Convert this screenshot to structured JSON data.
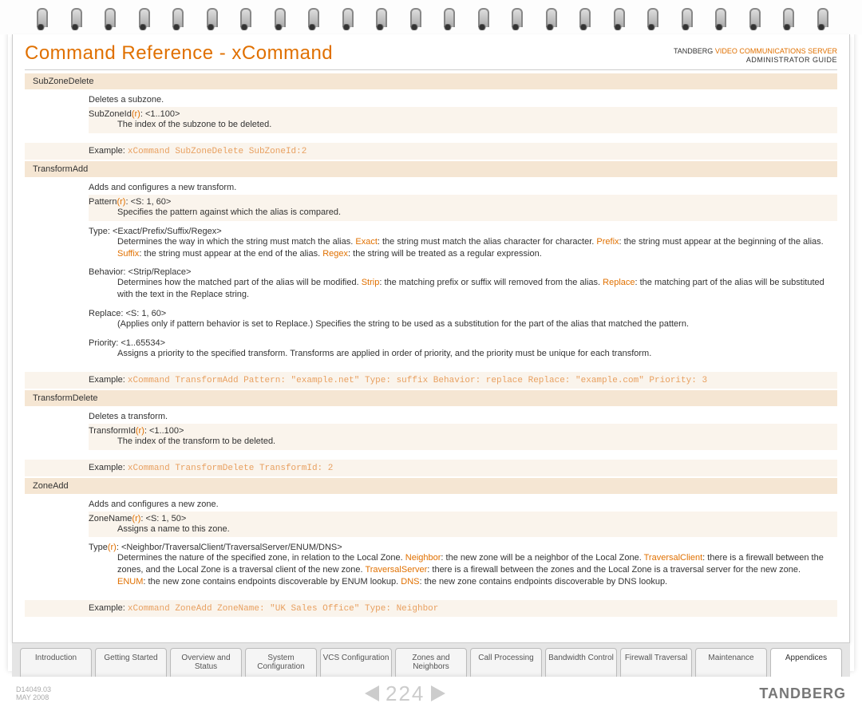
{
  "header": {
    "title": "Command Reference - xCommand",
    "brand_company": "TANDBERG",
    "brand_product": "VIDEO COMMUNICATIONS SERVER",
    "brand_subtitle": "ADMINISTRATOR GUIDE"
  },
  "commands": {
    "subzonedelete": {
      "name": "SubZoneDelete",
      "desc": "Deletes a subzone.",
      "p1_name": "SubZoneId",
      "p1_req": "(r)",
      "p1_range": ": <1..100>",
      "p1_detail": "The index of the subzone to be deleted.",
      "example_label": "Example:",
      "example_code": "xCommand SubZoneDelete SubZoneId:2"
    },
    "transformadd": {
      "name": "TransformAdd",
      "desc": "Adds and configures a new transform.",
      "p1_name": "Pattern",
      "p1_req": "(r)",
      "p1_range": ": <S: 1, 60>",
      "p1_detail": "Specifies the pattern against which the alias is compared.",
      "p2_name": "Type: <Exact/Prefix/Suffix/Regex>",
      "p2_detail_a": "Determines the way in which the string must match the alias. ",
      "p2_exact": "Exact",
      "p2_detail_b": ": the string must match the alias character for character. ",
      "p2_prefix": "Prefix",
      "p2_detail_c": ": the string must appear at the beginning of the alias. ",
      "p2_suffix": "Suffix",
      "p2_detail_d": ": the string must appear at the end of the alias. ",
      "p2_regex": "Regex",
      "p2_detail_e": ": the string will be treated as a regular expression.",
      "p3_name": "Behavior: <Strip/Replace>",
      "p3_detail_a": "Determines how the matched part of the alias will be modified. ",
      "p3_strip": "Strip",
      "p3_detail_b": ": the matching prefix or suffix will removed from the alias. ",
      "p3_replace": "Replace",
      "p3_detail_c": ": the matching part of the alias will be substituted with the text in the Replace string.",
      "p4_name": "Replace: <S: 1, 60>",
      "p4_detail": "(Applies only if pattern behavior is set to Replace.) Specifies the string to be used as a substitution for the part of the alias that matched the pattern.",
      "p5_name": "Priority: <1..65534>",
      "p5_detail": "Assigns a priority to the specified transform. Transforms are applied in order of priority, and the priority must be unique for each transform.",
      "example_label": "Example:",
      "example_code": "xCommand TransformAdd Pattern: \"example.net\" Type: suffix Behavior: replace Replace: \"example.com\" Priority: 3"
    },
    "transformdelete": {
      "name": "TransformDelete",
      "desc": "Deletes a transform.",
      "p1_name": "TransformId",
      "p1_req": "(r)",
      "p1_range": ": <1..100>",
      "p1_detail": "The index of the transform to be deleted.",
      "example_label": "Example:",
      "example_code": "xCommand TransformDelete TransformId: 2"
    },
    "zoneadd": {
      "name": "ZoneAdd",
      "desc": "Adds and configures a new zone.",
      "p1_name": "ZoneName",
      "p1_req": "(r)",
      "p1_range": ": <S: 1, 50>",
      "p1_detail": "Assigns a name to this zone.",
      "p2_name": "Type",
      "p2_req": "(r)",
      "p2_range": ": <Neighbor/TraversalClient/TraversalServer/ENUM/DNS>",
      "p2_detail_a": "Determines the nature of the specified zone, in relation to the Local Zone. ",
      "p2_neighbor": "Neighbor",
      "p2_detail_b": ": the new zone will be a neighbor of the Local Zone. ",
      "p2_travclient": "TraversalClient",
      "p2_detail_c": ": there is a firewall between the zones, and the Local Zone is a traversal client of the new zone. ",
      "p2_travserver": "TraversalServer",
      "p2_detail_d": ": there is a firewall between the zones and the Local Zone is a traversal server for the new zone. ",
      "p2_enum": "ENUM",
      "p2_detail_e": ": the new zone contains endpoints discoverable by ENUM lookup. ",
      "p2_dns": "DNS",
      "p2_detail_f": ": the new zone contains endpoints discoverable by DNS lookup.",
      "example_label": "Example:",
      "example_code": "xCommand ZoneAdd ZoneName: \"UK Sales Office\" Type: Neighbor"
    }
  },
  "tabs": [
    "Introduction",
    "Getting Started",
    "Overview and Status",
    "System Configuration",
    "VCS Configuration",
    "Zones and Neighbors",
    "Call Processing",
    "Bandwidth Control",
    "Firewall Traversal",
    "Maintenance",
    "Appendices"
  ],
  "footer": {
    "doc_id": "D14049.03",
    "doc_date": "MAY 2008",
    "page": "224",
    "logo": "TANDBERG"
  }
}
